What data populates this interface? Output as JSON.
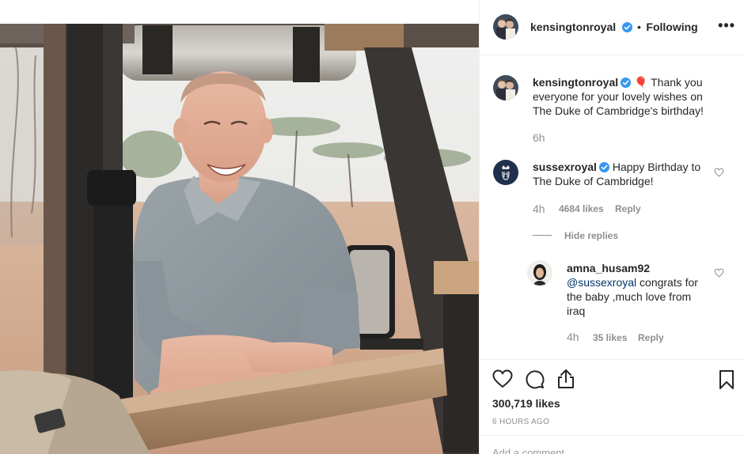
{
  "post": {
    "author": "kensingtonroyal",
    "follow_separator": "•",
    "follow_status": "Following",
    "more_label": "•••",
    "caption_emoji": "🎈",
    "caption": "Thank you everyone for your lovely wishes on The Duke of Cambridge's birthday!",
    "caption_age": "6h"
  },
  "comments": [
    {
      "user": "sussexroyal",
      "text": "Happy Birthday to The Duke of Cambridge!",
      "age": "4h",
      "likes": "4684 likes",
      "reply_label": "Reply",
      "hide_replies": "Hide replies"
    },
    {
      "user": "amna_husam92",
      "mention": "@sussexroyal",
      "text": "congrats for the baby ,much love from iraq",
      "age": "4h",
      "likes": "35 likes",
      "reply_label": "Reply"
    }
  ],
  "footer": {
    "likes_count": "300,719 likes",
    "time_ago": "6 HOURS AGO",
    "comment_placeholder": "Add a comment..."
  },
  "icons": {
    "like": "heart-icon",
    "comment": "comment-icon",
    "share": "share-icon",
    "save": "bookmark-icon",
    "verified": "verified-badge-icon"
  },
  "colors": {
    "verified_blue": "#3897f0",
    "text": "#262626",
    "muted": "#8e8e8e",
    "mention": "#003569"
  }
}
